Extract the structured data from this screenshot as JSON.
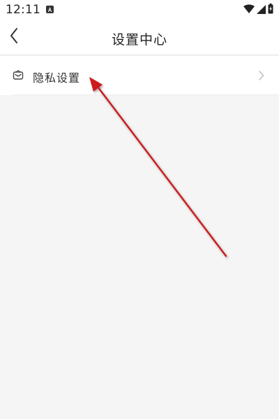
{
  "status_bar": {
    "time": "12:11",
    "icons": [
      "a-notification-icon",
      "wifi-icon",
      "signal-icon",
      "battery-icon"
    ]
  },
  "header": {
    "title": "设置中心",
    "back_icon": "chevron-left-icon"
  },
  "menu": {
    "items": [
      {
        "label": "隐私设置",
        "icon": "envelope-icon",
        "trailing_icon": "chevron-right-icon"
      }
    ]
  },
  "colors": {
    "background": "#f5f5f5",
    "surface": "#ffffff",
    "divider": "#ececec",
    "text_primary": "#222222",
    "annotation_arrow": "#cc1f1f"
  }
}
